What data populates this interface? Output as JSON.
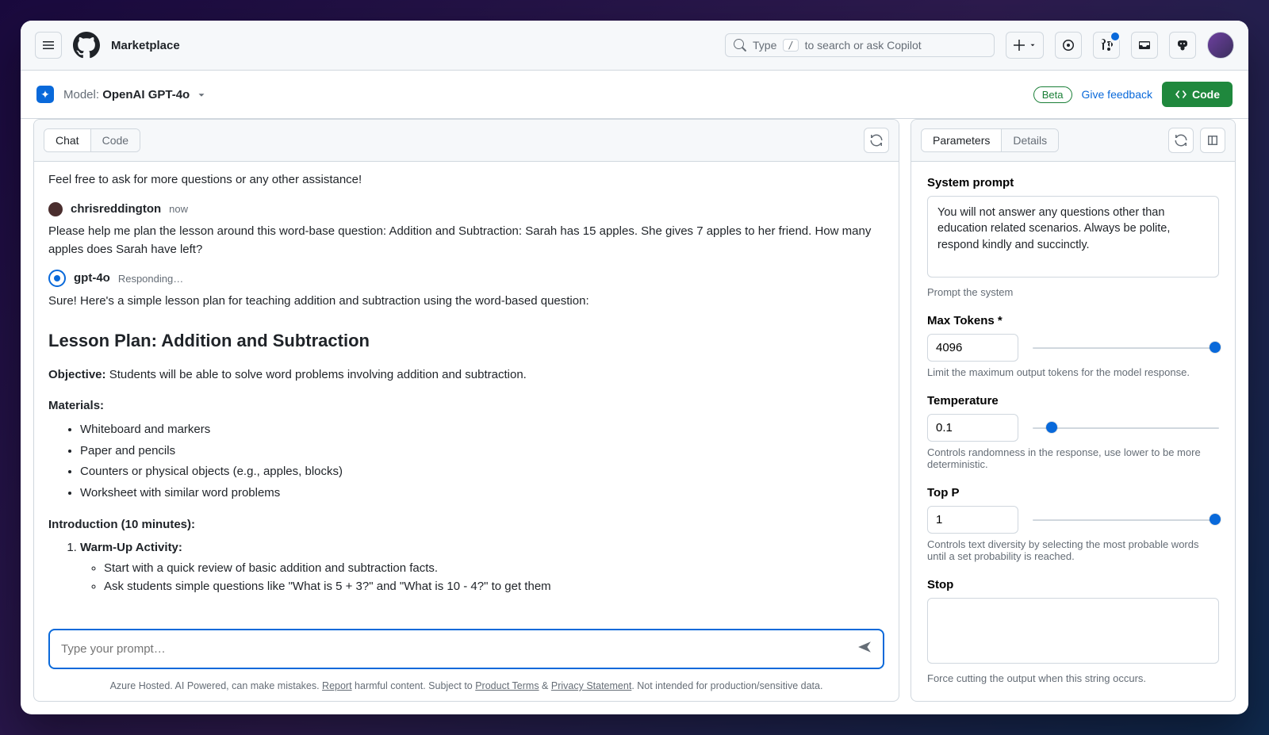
{
  "header": {
    "title": "Marketplace",
    "search_prefix": "Type ",
    "search_kbd": "/",
    "search_suffix": " to search or ask Copilot"
  },
  "subheader": {
    "model_prefix": "Model: ",
    "model_name": "OpenAI GPT-4o",
    "beta": "Beta",
    "feedback": "Give feedback",
    "code_btn": "Code"
  },
  "left_panel": {
    "tabs": {
      "chat": "Chat",
      "code": "Code"
    }
  },
  "chat": {
    "intro_followup": "Feel free to ask for more questions or any other assistance!",
    "user": {
      "name": "chrisreddington",
      "time": "now",
      "text": "Please help me plan the lesson around this word-base question: Addition and Subtraction: Sarah has 15 apples. She gives 7 apples to her friend. How many apples does Sarah have left?"
    },
    "bot": {
      "name": "gpt-4o",
      "status": "Responding…",
      "intro": "Sure! Here's a simple lesson plan for teaching addition and subtraction using the word-based question:",
      "lesson_title": "Lesson Plan: Addition and Subtraction",
      "objective_label": "Objective:",
      "objective_text": " Students will be able to solve word problems involving addition and subtraction.",
      "materials_label": "Materials:",
      "materials": [
        "Whiteboard and markers",
        "Paper and pencils",
        "Counters or physical objects (e.g., apples, blocks)",
        "Worksheet with similar word problems"
      ],
      "intro_label": "Introduction (10 minutes):",
      "warmup_label": "Warm-Up Activity:",
      "warmup_items": [
        "Start with a quick review of basic addition and subtraction facts.",
        "Ask students simple questions like \"What is 5 + 3?\" and \"What is 10 - 4?\" to get them"
      ]
    }
  },
  "prompt": {
    "placeholder": "Type your prompt…"
  },
  "footer": {
    "t1": "Azure Hosted. AI Powered, can make mistakes. ",
    "report": "Report",
    "t2": " harmful content. Subject to ",
    "product_terms": "Product Terms",
    "amp": " & ",
    "privacy": "Privacy Statement",
    "t3": ". Not intended for production/sensitive data."
  },
  "right_panel": {
    "tabs": {
      "parameters": "Parameters",
      "details": "Details"
    },
    "system_prompt_label": "System prompt",
    "system_prompt_value": "You will not answer any questions other than education related scenarios. Always be polite, respond kindly and succinctly.",
    "system_prompt_hint": "Prompt the system",
    "max_tokens": {
      "label": "Max Tokens *",
      "value": "4096",
      "hint": "Limit the maximum output tokens for the model response.",
      "thumb_pct": 98
    },
    "temperature": {
      "label": "Temperature",
      "value": "0.1",
      "hint": "Controls randomness in the response, use lower to be more deterministic.",
      "thumb_pct": 10
    },
    "top_p": {
      "label": "Top P",
      "value": "1",
      "hint": "Controls text diversity by selecting the most probable words until a set probability is reached.",
      "thumb_pct": 98
    },
    "stop": {
      "label": "Stop",
      "hint": "Force cutting the output when this string occurs."
    }
  }
}
